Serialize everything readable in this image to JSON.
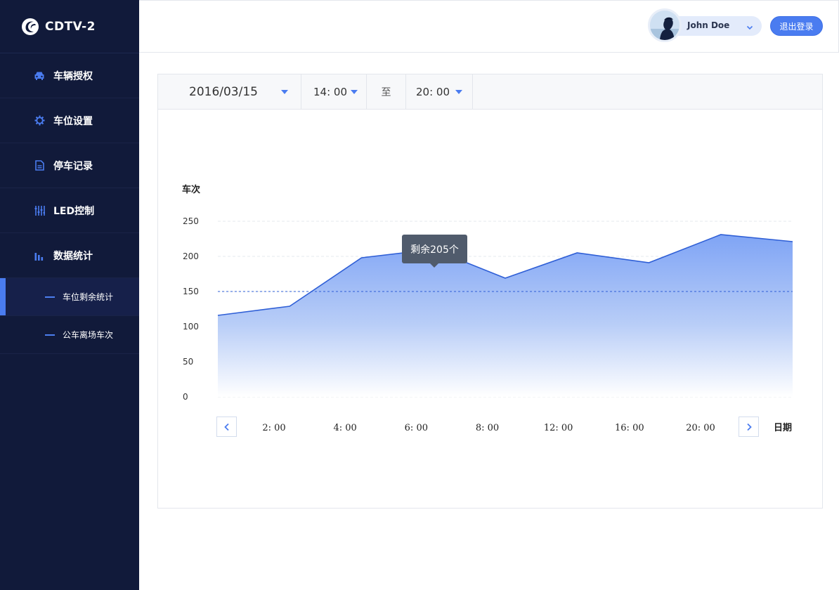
{
  "brand": {
    "name": "CDTV-2"
  },
  "sidebar": {
    "items": [
      {
        "label": "车辆授权",
        "icon": "car-icon"
      },
      {
        "label": "车位设置",
        "icon": "gear-icon"
      },
      {
        "label": "停车记录",
        "icon": "document-icon"
      },
      {
        "label": "LED控制",
        "icon": "sliders-icon"
      },
      {
        "label": "数据统计",
        "icon": "bar-chart-icon"
      }
    ],
    "sub_items": [
      {
        "label": "车位剩余统计",
        "active": true
      },
      {
        "label": "公车离场车次",
        "active": false
      }
    ]
  },
  "header": {
    "user_name": "John Doe",
    "logout_label": "退出登录"
  },
  "filters": {
    "date": "2016/03/15",
    "start_time": "14: 00",
    "to_label": "至",
    "end_time": "20: 00"
  },
  "colors": {
    "sidebar_bg": "#111a3a",
    "accent": "#4a7cf0",
    "line": "#2f5fd6",
    "tooltip_bg": "#505b6c"
  },
  "chart_data": {
    "type": "area",
    "ylabel": "车次",
    "xlabel": "日期",
    "ylim": [
      0,
      250
    ],
    "yticks": [
      "250",
      "200",
      "150",
      "100",
      "50",
      "0"
    ],
    "tick_labels": [
      "2: 00",
      "4: 00",
      "6: 00",
      "8: 00",
      "12: 00",
      "16: 00",
      "20: 00"
    ],
    "values": [
      116,
      129,
      198,
      210,
      169,
      205,
      191,
      231,
      221
    ],
    "reference_line": 150,
    "grid": true,
    "highlight": {
      "index": 3,
      "label": "剩余205个"
    }
  }
}
